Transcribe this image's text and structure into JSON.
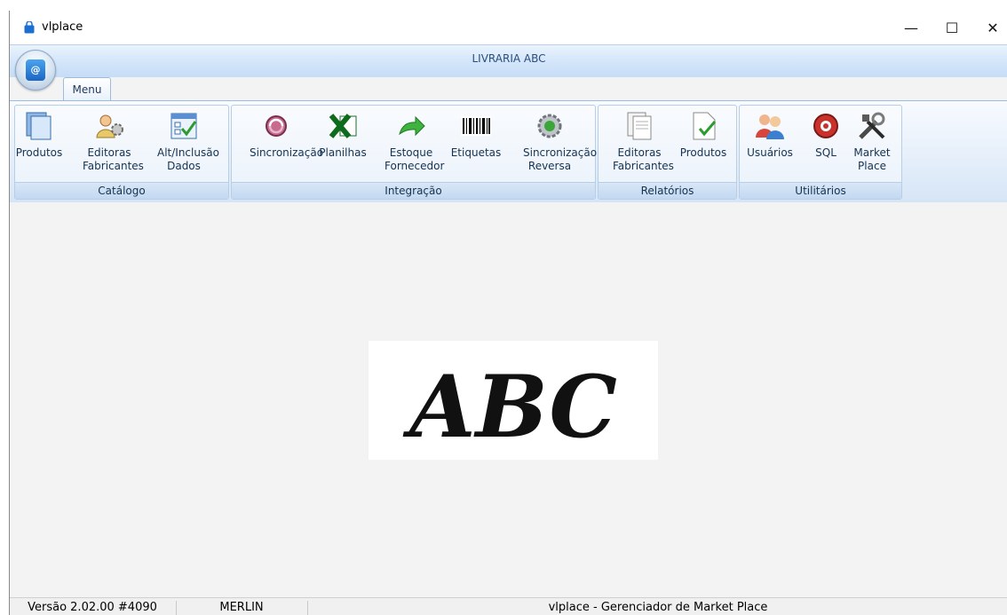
{
  "window": {
    "title": "vlplace",
    "app_header": "LIVRARIA ABC",
    "controls": {
      "minimize": "—",
      "maximize": "☐",
      "close": "✕"
    }
  },
  "ribbon": {
    "tab": "Menu",
    "groups": [
      {
        "label": "Catálogo",
        "buttons": [
          {
            "label": "Produtos",
            "icon": "documents-icon"
          },
          {
            "label": "Editoras\nFabricantes",
            "icon": "users-gear-icon"
          },
          {
            "label": "Alt/Inclusão\nDados",
            "icon": "form-check-icon"
          }
        ]
      },
      {
        "label": "Integração",
        "buttons": [
          {
            "label": "Sincronização",
            "icon": "sync-icon"
          },
          {
            "label": "Planilhas",
            "icon": "excel-icon"
          },
          {
            "label": "Estoque\nFornecedor",
            "icon": "green-arrow-icon"
          },
          {
            "label": "Etiquetas",
            "icon": "barcode-icon"
          },
          {
            "label": "Sincronização\nReversa",
            "icon": "reverse-sync-icon"
          }
        ]
      },
      {
        "label": "Relatórios",
        "buttons": [
          {
            "label": "Editoras\nFabricantes",
            "icon": "report-pages-icon"
          },
          {
            "label": "Produtos",
            "icon": "report-check-icon"
          }
        ]
      },
      {
        "label": "Utilitários",
        "buttons": [
          {
            "label": "Usuários",
            "icon": "users-icon"
          },
          {
            "label": "SQL",
            "icon": "sql-icon"
          },
          {
            "label": "Market\nPlace",
            "icon": "tools-icon"
          }
        ]
      }
    ]
  },
  "content": {
    "logo_text": "ABC"
  },
  "status": {
    "version": "Versão 2.02.00 #4090",
    "host": "MERLIN",
    "app_name": "vlplace - Gerenciador de Market Place"
  }
}
